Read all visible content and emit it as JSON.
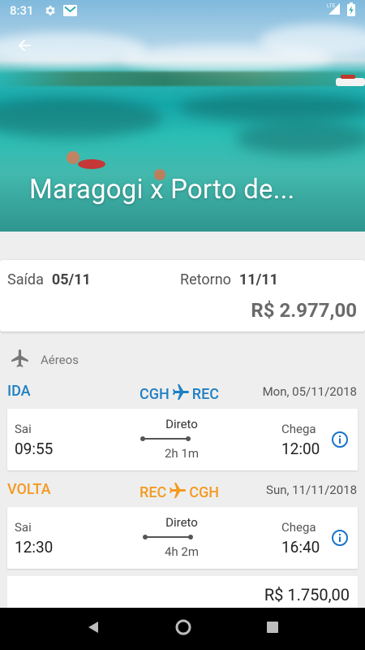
{
  "status_bar": {
    "time": "8:31",
    "network": "LTE",
    "icons": [
      "gear-icon",
      "gmail-icon",
      "signal-icon",
      "battery-charging-icon"
    ]
  },
  "hero": {
    "title": "Maragogi x Porto de...",
    "back_icon": "arrow-left-icon"
  },
  "summary": {
    "departure_label": "Saída",
    "departure_date": "05/11",
    "return_label": "Retorno",
    "return_date": "11/11",
    "total_price": "R$ 2.977,00"
  },
  "airfare": {
    "label": "Aéreos",
    "icon": "airplane-icon"
  },
  "legs": [
    {
      "direction": "IDA",
      "origin": "CGH",
      "destination": "REC",
      "date": "Mon, 05/11/2018",
      "depart_label": "Sai",
      "depart_time": "09:55",
      "type": "Direto",
      "duration": "2h 1m",
      "arrive_label": "Chega",
      "arrive_time": "12:00",
      "color": "#1f7fc3"
    },
    {
      "direction": "VOLTA",
      "origin": "REC",
      "destination": "CGH",
      "date": "Sun, 11/11/2018",
      "depart_label": "Sai",
      "depart_time": "12:30",
      "type": "Direto",
      "duration": "4h 2m",
      "arrive_label": "Chega",
      "arrive_time": "16:40",
      "color": "#f39a1f"
    }
  ],
  "price_card": {
    "price": "R$ 1.750,00"
  },
  "nav_bar": {
    "icons": [
      "back-triangle-icon",
      "home-circle-icon",
      "recents-square-icon"
    ]
  },
  "colors": {
    "accent_blue": "#1f7fc3",
    "accent_orange": "#f39a1f",
    "info_blue": "#1a73c9"
  }
}
